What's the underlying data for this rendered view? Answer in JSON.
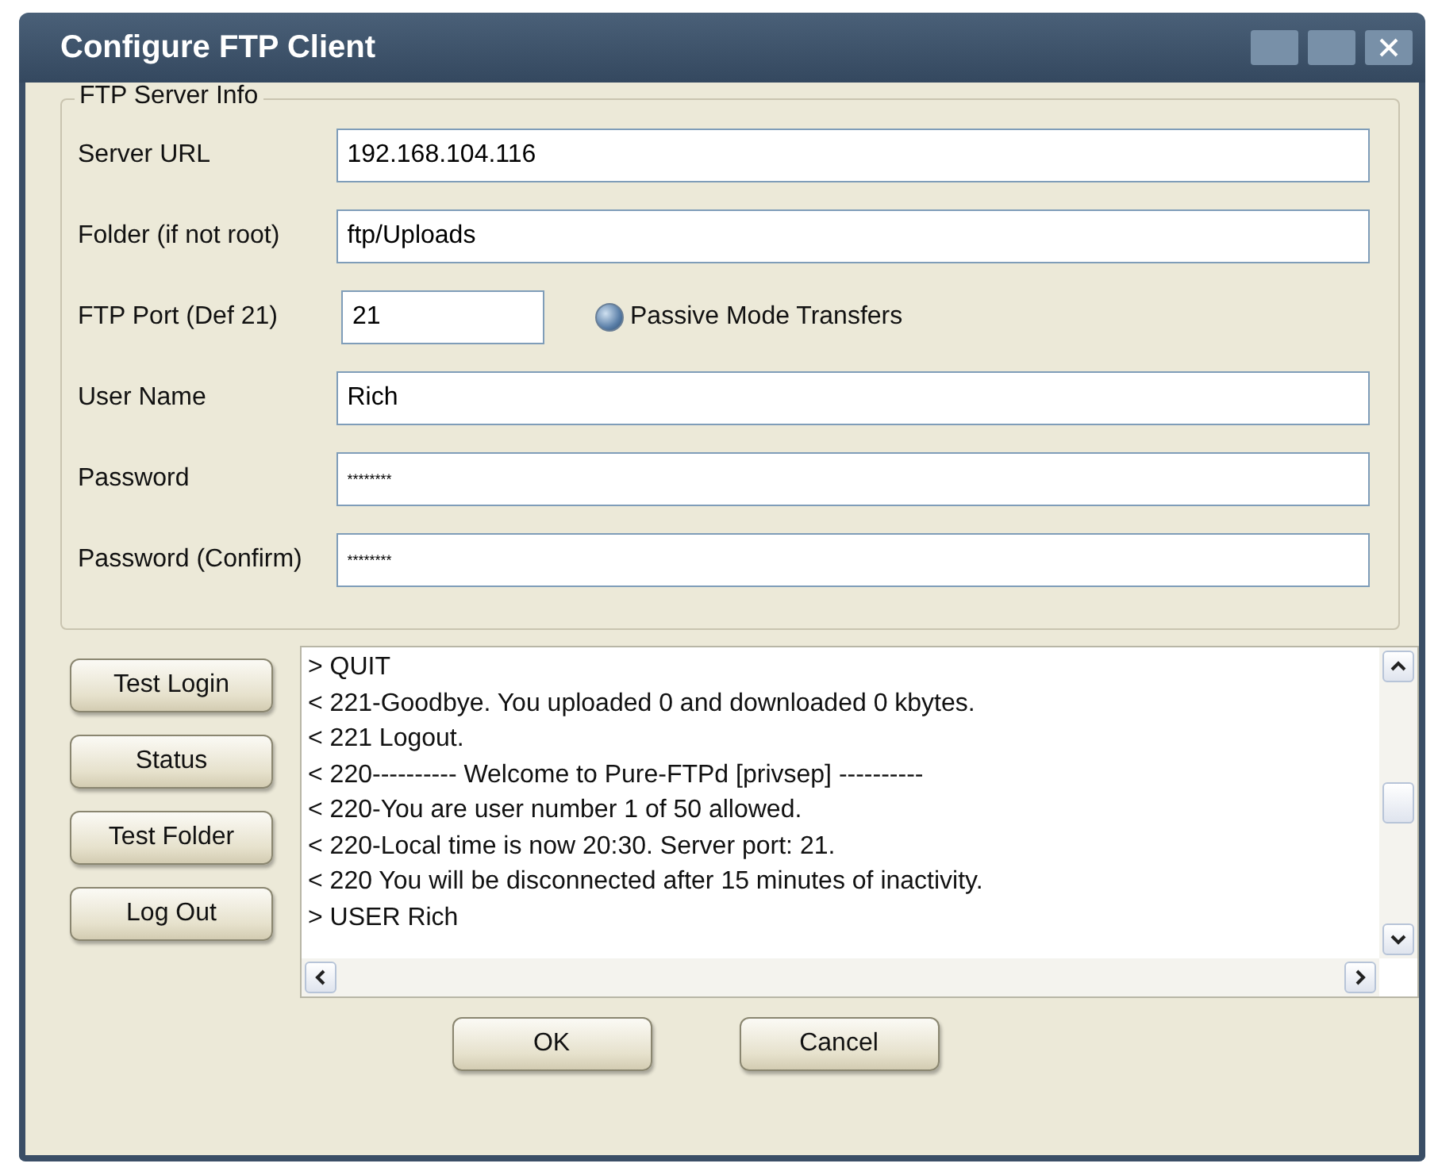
{
  "window": {
    "title": "Configure FTP Client"
  },
  "server_info": {
    "title": "FTP Server Info",
    "fields": [
      {
        "label": "Server URL",
        "value": "192.168.104.116",
        "kind": "wide"
      },
      {
        "label": "Folder (if not root)",
        "value": "ftp/Uploads",
        "kind": "wide"
      },
      {
        "label": "FTP Port  (Def 21)",
        "value": "21",
        "kind": "port"
      },
      {
        "label": "User Name",
        "value": "Rich",
        "kind": "wide"
      },
      {
        "label": "Password",
        "value": "********",
        "kind": "password"
      },
      {
        "label": "Password (Confirm)",
        "value": "********",
        "kind": "password"
      }
    ],
    "passive_mode": {
      "label": "Passive Mode Transfers",
      "checked": true
    }
  },
  "actions": [
    "Test Login",
    "Status",
    "Test Folder",
    "Log Out"
  ],
  "log": [
    "> QUIT",
    "< 221-Goodbye. You uploaded 0 and downloaded 0 kbytes.",
    "< 221 Logout.",
    "< 220---------- Welcome to Pure-FTPd [privsep] ----------",
    "< 220-You are user number 1 of 50 allowed.",
    "< 220-Local time is now 20:30. Server port: 21.",
    "< 220 You will be disconnected after 15 minutes of inactivity.",
    "> USER Rich"
  ],
  "buttons": [
    "OK",
    "Cancel"
  ]
}
